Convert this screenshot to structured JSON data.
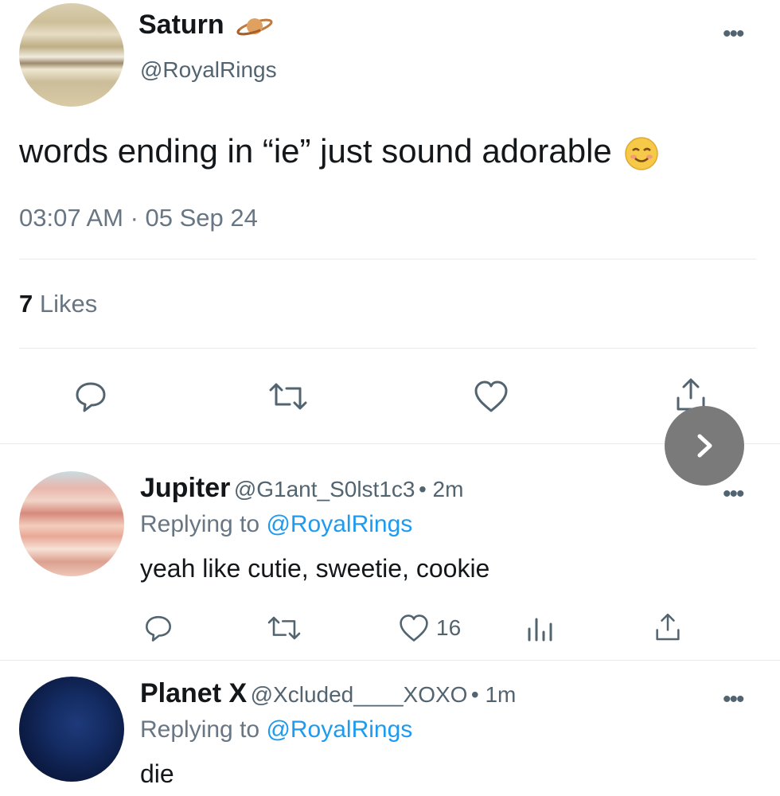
{
  "main_tweet": {
    "display_name": "Saturn",
    "name_emoji": "ringed-planet-emoji",
    "handle": "@RoyalRings",
    "text": "words ending in “ie” just sound adorable",
    "text_emoji": "smiling-face-emoji",
    "timestamp": "03:07 AM · 05 Sep 24",
    "likes_count": "7",
    "likes_label": "Likes"
  },
  "replies": [
    {
      "display_name": "Jupiter",
      "handle": "@G1ant_S0lst1c3",
      "time": "• 2m",
      "replying_prefix": "Replying to",
      "replying_handle": "@RoyalRings",
      "text": "yeah like cutie, sweetie, cookie",
      "like_count": "16"
    },
    {
      "display_name": "Planet X",
      "handle": "@Xcluded____XOXO",
      "time": "• 1m",
      "replying_prefix": "Replying to",
      "replying_handle": "@RoyalRings",
      "text": "die"
    }
  ],
  "colors": {
    "link": "#1d9bf0",
    "muted": "#687684",
    "divider": "#e6ecf0",
    "next_button": "#7a7a7a"
  }
}
